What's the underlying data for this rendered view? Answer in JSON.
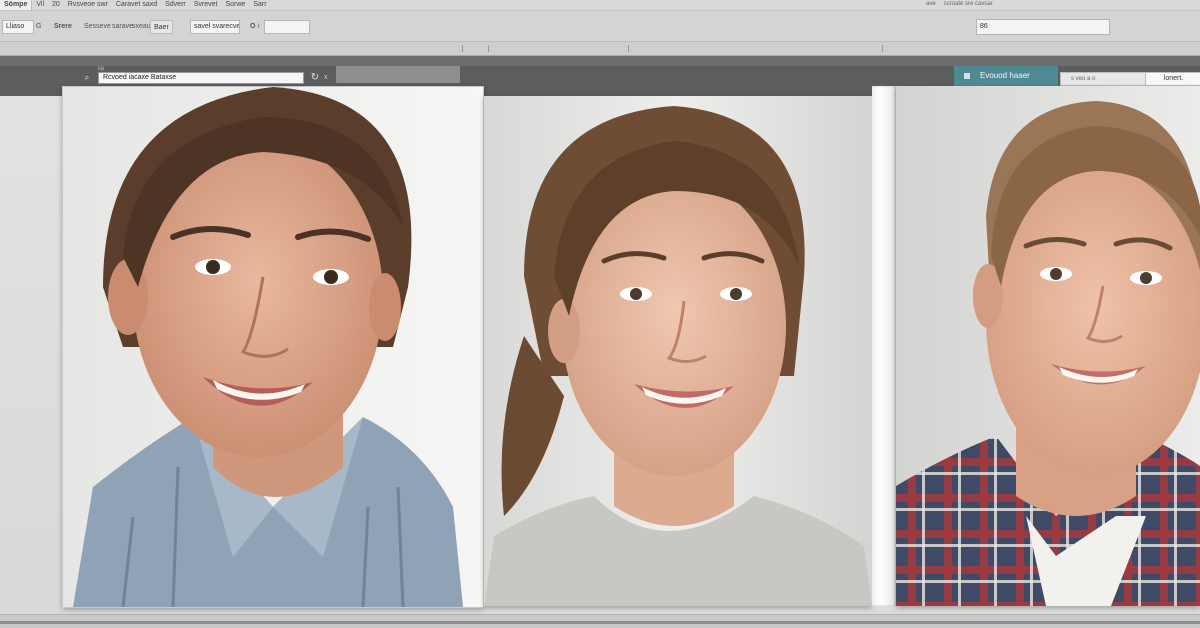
{
  "menubar": {
    "items": [
      "Sömpe",
      "Vil",
      "20",
      "Rvsveoe swr",
      "Caravet saxd",
      "Sdverr",
      "Svrevet",
      "Sorwe",
      "Sarr"
    ],
    "status": [
      "ave",
      "scroate sre cavsar"
    ]
  },
  "toolbar": {
    "field1": "Lliaso",
    "field1_suffix": "G",
    "label1": "Srere",
    "label2": "Sesseve",
    "label3": "sarave",
    "label4": "sxeaux",
    "btn1": "Baer",
    "field2": "savel svarecve",
    "btn2": "O",
    "btn2_suffix": "i",
    "right_field": "86"
  },
  "ribbon": {
    "marks": [
      "iia"
    ],
    "doc_input": "Rcvoed iacaxe Bataxse",
    "icon_label": "x",
    "action_label": "Evouod haaer",
    "right_panel_left": "s veo a o",
    "right_panel_right": "lonert."
  },
  "photos": [
    {
      "name": "portrait-1",
      "shirt": "denim-blue"
    },
    {
      "name": "portrait-2",
      "shirt": "grey-sweater"
    },
    {
      "name": "portrait-3",
      "shirt": "plaid-red"
    }
  ]
}
